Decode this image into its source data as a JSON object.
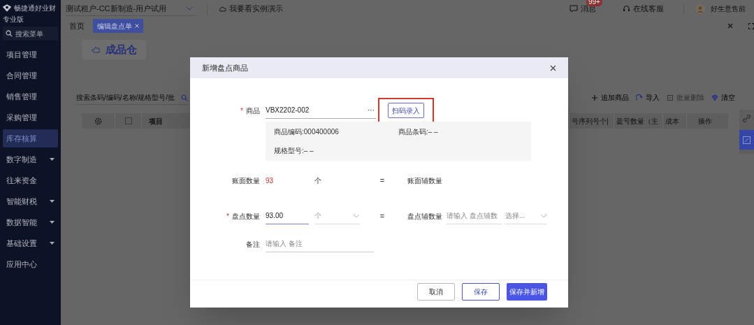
{
  "sidebar": {
    "brand": "畅捷通好业财",
    "edition": "专业版",
    "search_placeholder": "搜索菜单",
    "items": [
      {
        "label": "项目管理",
        "expandable": false,
        "selected": false
      },
      {
        "label": "合同管理",
        "expandable": false,
        "selected": false
      },
      {
        "label": "销售管理",
        "expandable": false,
        "selected": false
      },
      {
        "label": "采购管理",
        "expandable": false,
        "selected": false
      },
      {
        "label": "库存核算",
        "expandable": false,
        "selected": true
      },
      {
        "label": "数字制造",
        "expandable": true,
        "selected": false
      },
      {
        "label": "往来资金",
        "expandable": false,
        "selected": false
      },
      {
        "label": "智能财税",
        "expandable": true,
        "selected": false
      },
      {
        "label": "数据智能",
        "expandable": true,
        "selected": false
      },
      {
        "label": "基础设置",
        "expandable": true,
        "selected": false
      },
      {
        "label": "应用中心",
        "expandable": false,
        "selected": false
      }
    ]
  },
  "header": {
    "tenant": "测试租户-CC新制造-用户试用",
    "demo_link": "我要看实例演示",
    "messages": "消息",
    "badge": "99+",
    "support": "在线客服",
    "user": "好生意售前"
  },
  "tabs": [
    {
      "label": "首页",
      "selected": false,
      "closable": false
    },
    {
      "label": "编辑盘点单",
      "selected": true,
      "closable": true
    }
  ],
  "page": {
    "warehouse": "成品仓",
    "search_placeholder": "搜索条码/编码/名称/规格型号/批",
    "toolbar": [
      {
        "label": "追加商品",
        "kind": "add",
        "disabled": false
      },
      {
        "label": "导入",
        "kind": "import",
        "disabled": false
      },
      {
        "label": "批量删除",
        "kind": "delete",
        "disabled": true
      },
      {
        "label": "清空",
        "kind": "clear",
        "disabled": false
      }
    ],
    "select_all_checked": false,
    "columns_left": [
      "项目"
    ],
    "columns_right": [
      "号序列号个|",
      "盈亏数量（主",
      "成本",
      "操作"
    ]
  },
  "dialog": {
    "title": "新增盘点商品",
    "product": {
      "required_mark": "*",
      "label": "商品",
      "value": "VBX2202-002",
      "more": "···",
      "scan_button": "扫码录入",
      "highlighted": true
    },
    "info": [
      "商品编码:000400006",
      "商品条码:– –",
      "规格型号:– –"
    ],
    "book_qty": {
      "label": "账面数量",
      "value": "93",
      "unit": "个",
      "equals": "=",
      "aux_label": "账面辅数量"
    },
    "count_qty": {
      "required_mark": "*",
      "label": "盘点数量",
      "value": "93.00",
      "unit": "个",
      "equals": "=",
      "aux_label": "盘点辅数量",
      "aux_placeholder": "请输入 盘点辅数",
      "aux_unit_placeholder": "选择..."
    },
    "remark": {
      "label": "备注",
      "placeholder": "请输入 备注"
    },
    "buttons": [
      {
        "label": "取消",
        "kind": "default"
      },
      {
        "label": "保存",
        "kind": "outline"
      },
      {
        "label": "保存并新增",
        "kind": "primary"
      }
    ]
  }
}
